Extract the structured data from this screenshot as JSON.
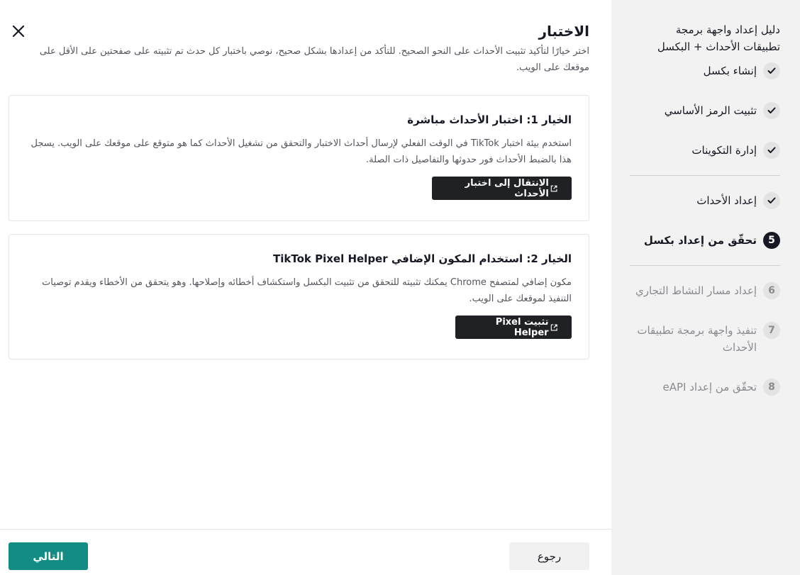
{
  "sidebar": {
    "title": "دليل إعداد واجهة برمجة تطبيقات الأحداث + البكسل",
    "steps": [
      {
        "label": "إنشاء بكسل",
        "state": "done"
      },
      {
        "label": "تثبيت الرمز الأساسي",
        "state": "done"
      },
      {
        "label": "إدارة التكوينات",
        "state": "done"
      },
      {
        "label": "إعداد الأحداث",
        "state": "done"
      },
      {
        "label": "تحقّق من إعداد بكسل",
        "state": "current",
        "number": "5"
      },
      {
        "label": "إعداد مسار النشاط التجاري",
        "state": "future",
        "number": "6"
      },
      {
        "label": "تنفيذ واجهة برمجة تطبيقات الأحداث",
        "state": "future",
        "number": "7"
      },
      {
        "label": "تحقّق من إعداد eAPI",
        "state": "future",
        "number": "8"
      }
    ]
  },
  "main": {
    "title": "الاختبار",
    "description": "اختر خيارًا لتأكيد تثبيت الأحداث على النحو الصحيح. للتأكد من إعدادها بشكل صحيح، نوصي باختبار كل حدث تم تثبيته على صفحتين على الأقل على موقعك على الويب.",
    "option1": {
      "title": "الخيار 1: اختبار الأحداث مباشرة",
      "description": "استخدم بيئة اختبار TikTok في الوقت الفعلي لإرسال أحداث الاختبار والتحقق من تشغيل الأحداث كما هو متوقع على موقعك على الويب. يسجل هذا بالضبط الأحداث فور حدوثها والتفاصيل ذات الصلة.",
      "button": "الانتقال إلى اختبار الأحداث"
    },
    "option2": {
      "title": "الخيار 2: استخدام المكون الإضافي TikTok Pixel Helper",
      "description": "مكون إضافي لمتصفح Chrome يمكنك تثبيته للتحقق من تثبيت البكسل واستكشاف أخطائه وإصلاحها. وهو يتحقق من الأخطاء ويقدم توصيات التنفيذ لموقعك على الويب.",
      "button": "تثبيت Pixel Helper"
    }
  },
  "footer": {
    "next": "التالي",
    "back": "رجوع"
  },
  "colors": {
    "primary": "#138c83",
    "dark_button": "#202124",
    "sidebar_bg": "#f2f2f2"
  }
}
